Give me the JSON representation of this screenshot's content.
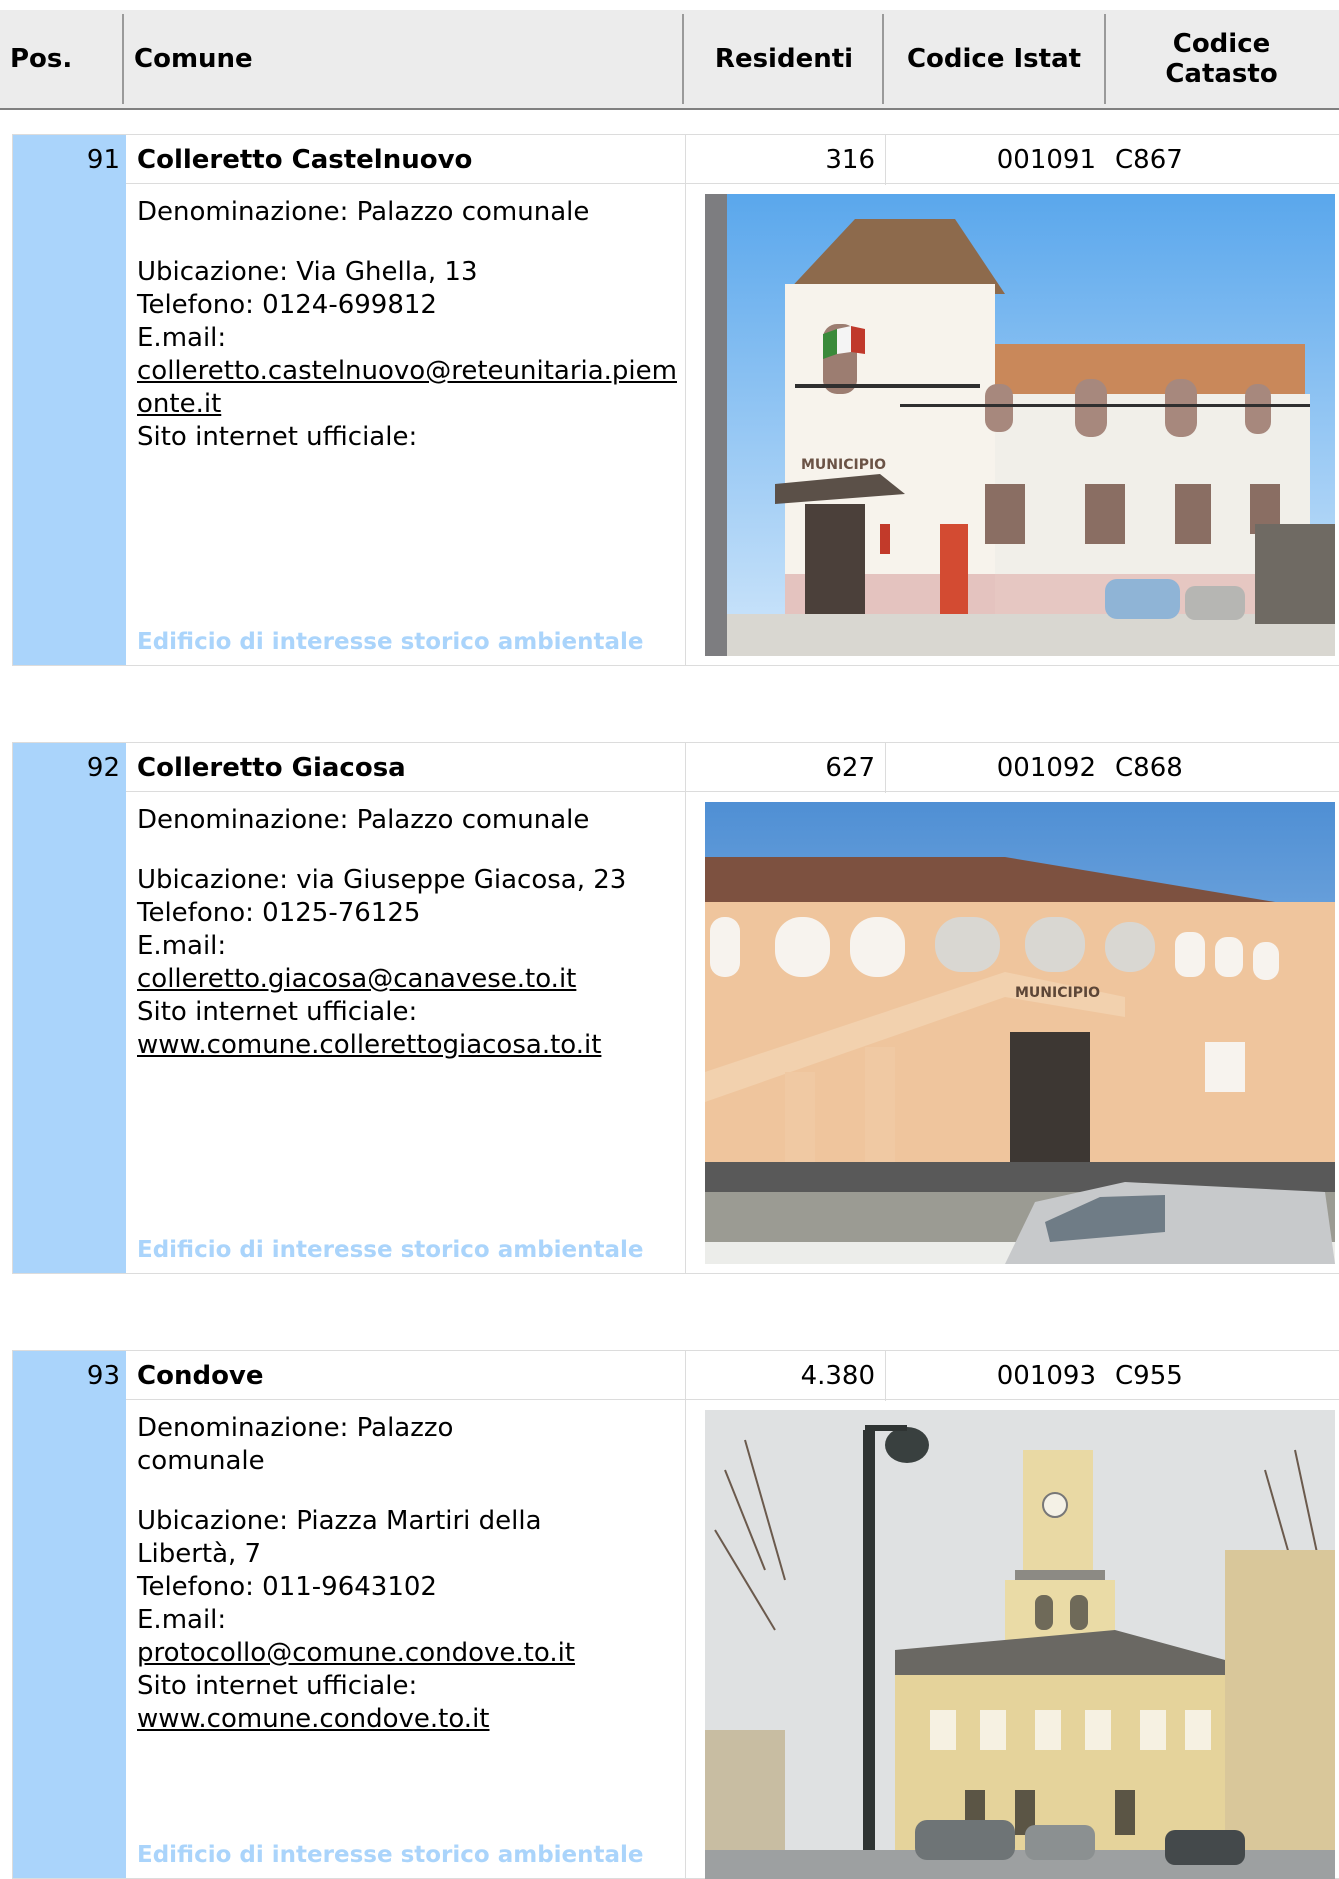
{
  "header": {
    "pos": "Pos.",
    "comune": "Comune",
    "residenti": "Residenti",
    "codice_istat": "Codice Istat",
    "codice_catasto_line1": "Codice",
    "codice_catasto_line2": "Catasto"
  },
  "records": [
    {
      "pos": "91",
      "comune": "Colleretto Castelnuovo",
      "residenti": "316",
      "istat": "001091",
      "catasto": "C867",
      "denominazione": "Denominazione: Palazzo comunale",
      "ubicazione": "Ubicazione: Via Ghella, 13",
      "telefono": "Telefono: 0124-699812",
      "email_label": "E.mail:",
      "email": "colleretto.castelnuovo@reteunitaria.piemonte.it",
      "sito_label": "Sito internet ufficiale:",
      "sito": "",
      "note": "Edificio di interesse storico ambientale"
    },
    {
      "pos": "92",
      "comune": "Colleretto Giacosa",
      "residenti": "627",
      "istat": "001092",
      "catasto": "C868",
      "denominazione": "Denominazione: Palazzo comunale",
      "ubicazione": "Ubicazione: via Giuseppe Giacosa, 23",
      "telefono": "Telefono: 0125-76125",
      "email_label": "E.mail:",
      "email": "colleretto.giacosa@canavese.to.it",
      "sito_label": "Sito internet ufficiale:",
      "sito": "www.comune.collerettogiacosa.to.it",
      "note": "Edificio di interesse storico ambientale"
    },
    {
      "pos": "93",
      "comune": "Condove",
      "residenti": "4.380",
      "istat": "001093",
      "catasto": "C955",
      "denominazione": "Denominazione: Palazzo comunale",
      "ubicazione": "Ubicazione: Piazza Martiri della Libertà, 7",
      "telefono": "Telefono: 011-9643102",
      "email_label": "E.mail:",
      "email": "protocollo@comune.condove.to.it",
      "sito_label": "Sito internet ufficiale:",
      "sito": "www.comune.condove.to.it",
      "note": "Edificio di interesse storico ambientale"
    }
  ],
  "photo_labels": {
    "municipio": "MUNICIPIO"
  }
}
